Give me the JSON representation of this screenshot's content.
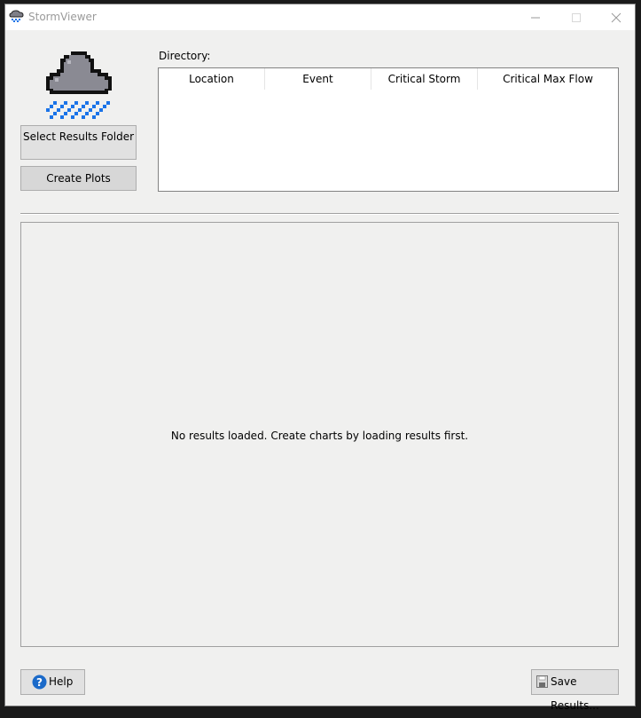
{
  "window": {
    "title": "StormViewer"
  },
  "left": {
    "select_button": "Select Results Folder",
    "plots_button": "Create Plots"
  },
  "directory": {
    "label": "Directory:",
    "columns": [
      "Location",
      "Event",
      "Critical Storm",
      "Critical Max Flow"
    ]
  },
  "plot_area": {
    "message": "No results loaded. Create charts by loading results first."
  },
  "footer": {
    "help_button": "Help",
    "save_button": "Save Results..."
  },
  "colors": {
    "cloud_body": "#8a8a93",
    "rain": "#1a73e8",
    "help_icon": "#1b6ac9"
  },
  "icons": {
    "app": "rain-cloud-icon",
    "help": "question-mark-icon",
    "save": "floppy-disk-icon"
  }
}
